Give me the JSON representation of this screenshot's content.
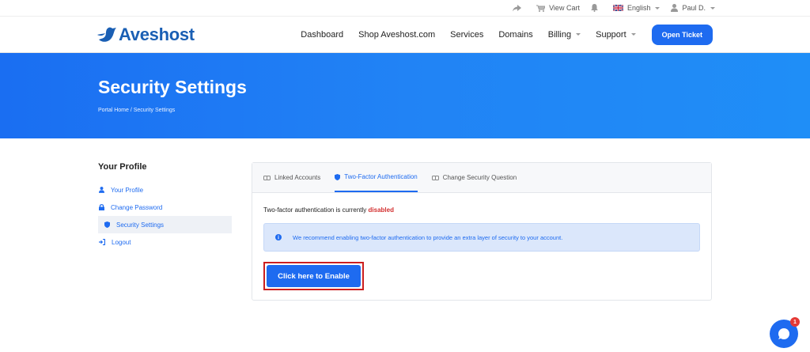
{
  "topbar": {
    "view_cart": "View Cart",
    "language": "English",
    "user": "Paul D."
  },
  "header": {
    "logo": "Aveshost",
    "nav": [
      "Dashboard",
      "Shop Aveshost.com",
      "Services",
      "Domains",
      "Billing",
      "Support"
    ],
    "open_ticket": "Open Ticket"
  },
  "hero": {
    "title": "Security Settings",
    "breadcrumb": "Portal Home  /  Security Settings"
  },
  "sidebar": {
    "heading": "Your Profile",
    "items": [
      {
        "label": "Your Profile",
        "icon": "user-icon"
      },
      {
        "label": "Change Password",
        "icon": "lock-icon"
      },
      {
        "label": "Security Settings",
        "icon": "shield-icon"
      },
      {
        "label": "Logout",
        "icon": "logout-icon"
      }
    ]
  },
  "tabs": [
    "Linked Accounts",
    "Two-Factor Authentication",
    "Change Security Question"
  ],
  "content": {
    "status_prefix": "Two-factor authentication is currently ",
    "status_value": "disabled",
    "alert": "We recommend enabling two-factor authentication to provide an extra layer of security to your account.",
    "enable_button": "Click here to Enable"
  },
  "chat": {
    "badge": "1"
  },
  "colors": {
    "accent": "#1e6bf0",
    "disabled": "#d32f2f",
    "highlight_border": "#cc1f1f"
  }
}
